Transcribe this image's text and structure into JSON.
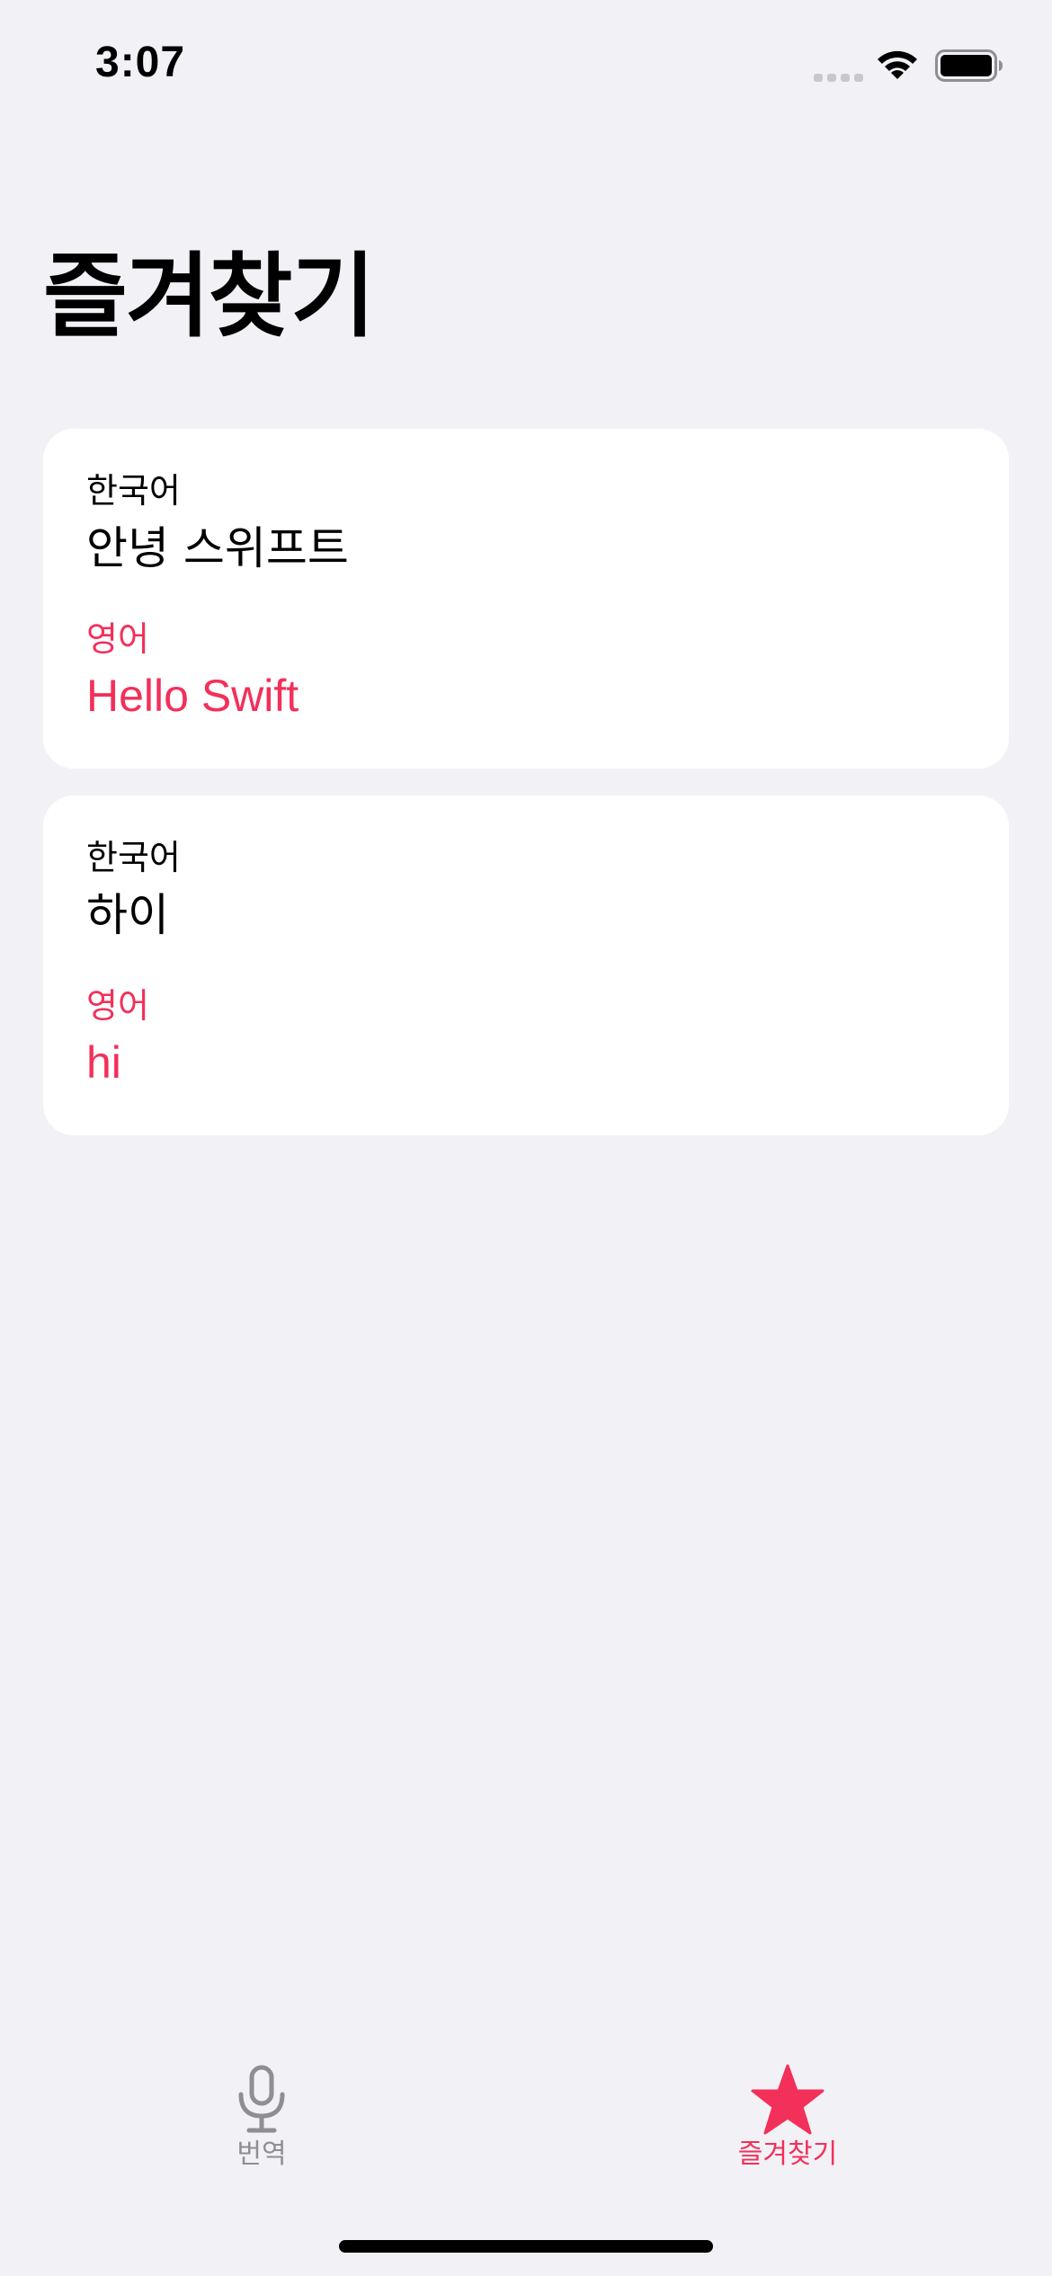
{
  "status_bar": {
    "time": "3:07",
    "signal_icon": "cellular-signal-icon",
    "wifi_icon": "wifi-icon",
    "battery_icon": "battery-icon"
  },
  "page": {
    "title": "즐겨찾기"
  },
  "favorites": [
    {
      "source_language": "한국어",
      "source_text": "안녕 스위프트",
      "target_language": "영어",
      "target_text": "Hello Swift"
    },
    {
      "source_language": "한국어",
      "source_text": "하이",
      "target_language": "영어",
      "target_text": "hi"
    }
  ],
  "tab_bar": {
    "tabs": [
      {
        "label": "번역",
        "icon": "microphone-icon",
        "selected": false
      },
      {
        "label": "즐겨찾기",
        "icon": "star-icon",
        "selected": true
      }
    ]
  },
  "colors": {
    "background": "#F2F1F6",
    "card": "#FFFFFF",
    "accent": "#F2305A",
    "inactive_tab": "#8E8E93"
  }
}
